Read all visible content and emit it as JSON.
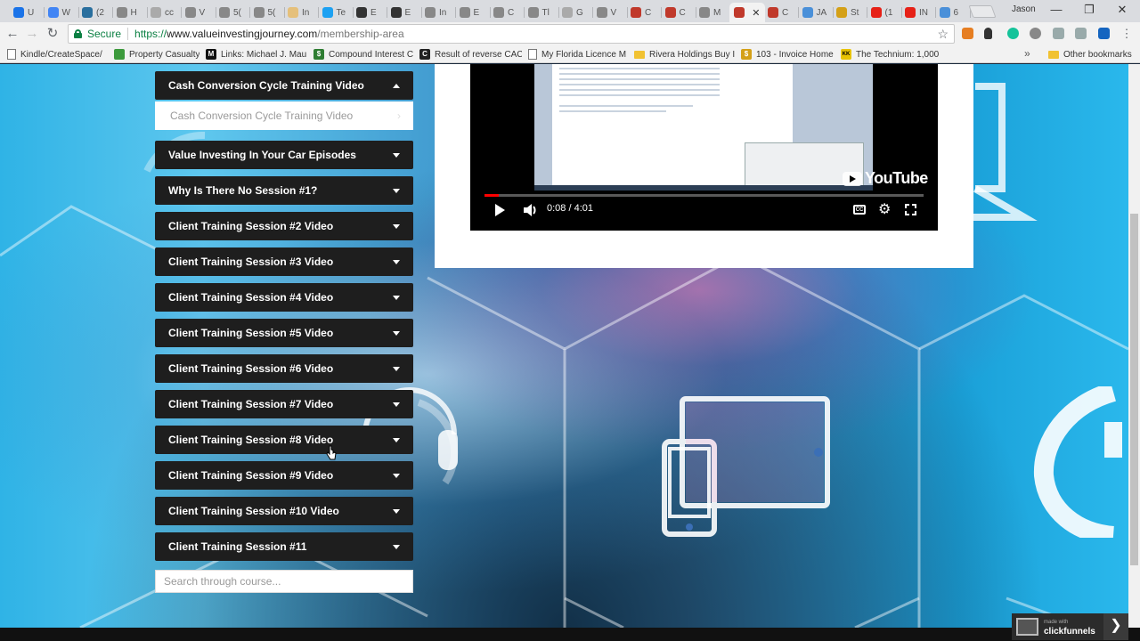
{
  "browser": {
    "tabs": [
      {
        "label": "U",
        "color": "#1a73e8"
      },
      {
        "label": "W",
        "color": "#4285f4"
      },
      {
        "label": "(2",
        "color": "#2a6f9e"
      },
      {
        "label": "H",
        "color": "#888888"
      },
      {
        "label": "cc",
        "color": "#aaaaaa"
      },
      {
        "label": "V",
        "color": "#888888"
      },
      {
        "label": "5(",
        "color": "#888888"
      },
      {
        "label": "5(",
        "color": "#888888"
      },
      {
        "label": "In",
        "color": "#e5c07b"
      },
      {
        "label": "Te",
        "color": "#1da1f2"
      },
      {
        "label": "E",
        "color": "#333333"
      },
      {
        "label": "E",
        "color": "#333333"
      },
      {
        "label": "In",
        "color": "#888888"
      },
      {
        "label": "E",
        "color": "#888888"
      },
      {
        "label": "C",
        "color": "#888888"
      },
      {
        "label": "Tl",
        "color": "#888888"
      },
      {
        "label": "G",
        "color": "#aaaaaa"
      },
      {
        "label": "V",
        "color": "#888888"
      },
      {
        "label": "C",
        "color": "#c0392b"
      },
      {
        "label": "C",
        "color": "#c0392b"
      },
      {
        "label": "M",
        "color": "#888888"
      },
      {
        "label": "",
        "color": "#c0392b",
        "active": true
      },
      {
        "label": "C",
        "color": "#c0392b"
      },
      {
        "label": "JA",
        "color": "#4a90d9"
      },
      {
        "label": "St",
        "color": "#d4a017"
      },
      {
        "label": "(1",
        "color": "#e62117"
      },
      {
        "label": "IN",
        "color": "#e62117"
      },
      {
        "label": "6",
        "color": "#4a90d9"
      }
    ],
    "profile_name": "Jason",
    "window_controls": {
      "minimize": "—",
      "maximize": "❐",
      "close": "✕"
    },
    "secure_label": "Secure",
    "url_scheme": "https://",
    "url_host": "www.valueinvestingjourney.com",
    "url_path": "/membership-area",
    "bookmarks": [
      {
        "label": "Kindle/CreateSpace/",
        "icon": "page-icon"
      },
      {
        "label": "Property Casualty",
        "icon": "green-icon",
        "color": "#3c9a3c"
      },
      {
        "label": "Links: Michael J. Mau",
        "icon": "cube-icon",
        "color": "#111111",
        "glyph": "M"
      },
      {
        "label": "Compound Interest C",
        "icon": "dollar-icon",
        "color": "#2e7d32",
        "glyph": "$"
      },
      {
        "label": "Result of reverse CAC",
        "icon": "c-icon",
        "color": "#222222",
        "glyph": "C"
      },
      {
        "label": "My Florida Licence M",
        "icon": "page-icon"
      },
      {
        "label": "Rivera Holdings Buy I",
        "icon": "folder-icon"
      },
      {
        "label": "103 - Invoice Home",
        "icon": "dollar-icon",
        "color": "#d4a017",
        "glyph": "$"
      },
      {
        "label": "The Technium: 1,000",
        "icon": "kk-icon",
        "color": "#e8c300",
        "glyph": "KK"
      }
    ],
    "bookmarks_more": "»",
    "other_bookmarks": "Other bookmarks"
  },
  "course": {
    "open_module": "Cash Conversion Cycle Training Video",
    "open_lesson": "Cash Conversion Cycle Training Video",
    "modules": [
      "Value Investing In Your Car Episodes",
      "Why Is There No Session #1?",
      "Client Training Session #2 Video",
      "Client Training Session #3 Video",
      "Client Training Session #4 Video",
      "Client Training Session #5 Video",
      "Client Training Session #6 Video",
      "Client Training Session #7 Video",
      "Client Training Session #8 Video",
      "Client Training Session #9 Video",
      "Client Training Session #10 Video",
      "Client Training Session #11"
    ],
    "search_placeholder": "Search through course..."
  },
  "video": {
    "brand": "YouTube",
    "current_time": "0:08",
    "duration": "4:01",
    "time_display": "0:08 / 4:01",
    "progress_fraction": 0.033,
    "cc_label": "CC"
  },
  "badge": {
    "small_text": "made with",
    "brand": "clickfunnels",
    "arrow": "❯"
  }
}
